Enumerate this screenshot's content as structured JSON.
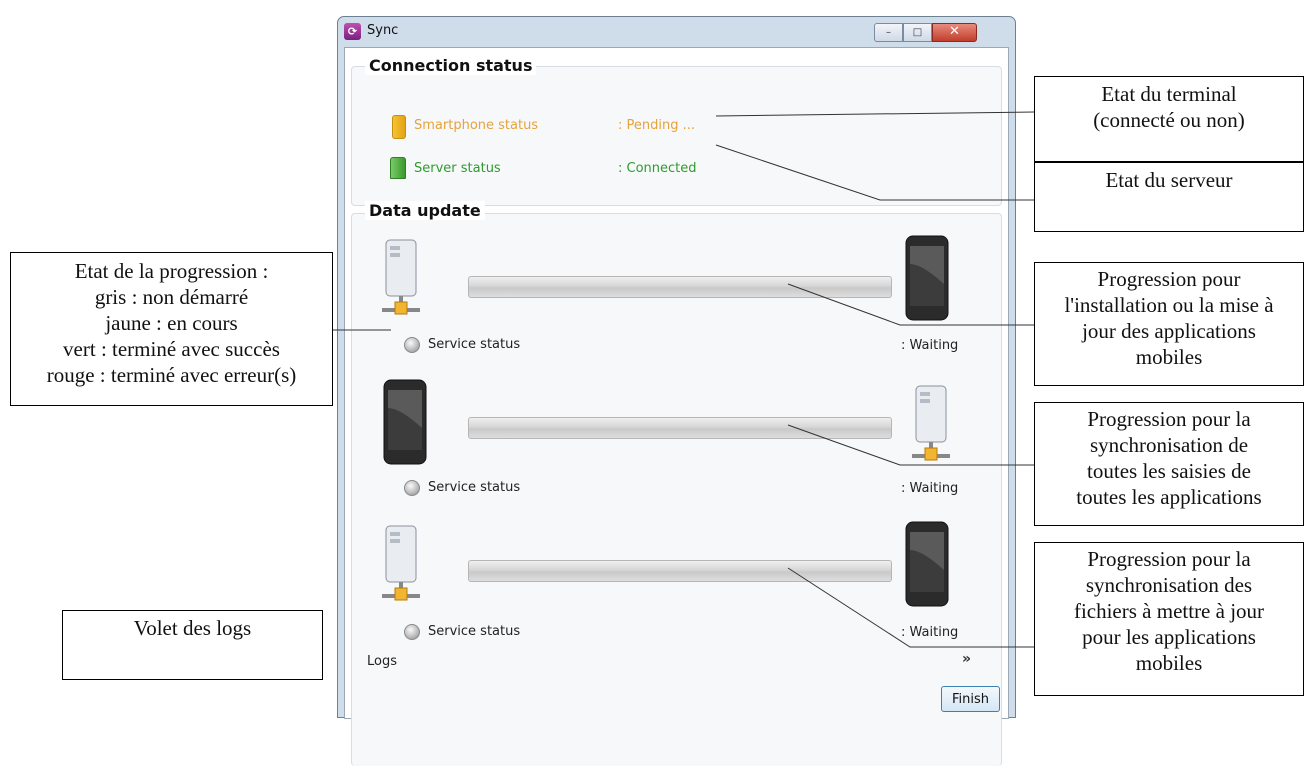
{
  "window": {
    "title": "Sync",
    "app_icon": "sync-app-icon",
    "controls": {
      "minimize": "–",
      "maximize": "□",
      "close": "✕"
    }
  },
  "connection_status": {
    "title": "Connection status",
    "smartphone": {
      "label": "Smartphone status",
      "value": ": Pending ...",
      "color": "#e6a23c",
      "icon": "smartphone-icon"
    },
    "server": {
      "label": "Server status",
      "value": ": Connected",
      "color": "#2f9a2f",
      "icon": "server-icon"
    }
  },
  "data_update": {
    "title": "Data update",
    "rows": [
      {
        "left_icon": "server-icon",
        "right_icon": "smartphone-icon",
        "service_label": "Service status",
        "status": ": Waiting",
        "progress": 0
      },
      {
        "left_icon": "smartphone-icon",
        "right_icon": "server-icon",
        "service_label": "Service status",
        "status": ": Waiting",
        "progress": 0
      },
      {
        "left_icon": "server-icon",
        "right_icon": "smartphone-icon",
        "service_label": "Service status",
        "status": ": Waiting",
        "progress": 0
      }
    ]
  },
  "logs": {
    "label": "Logs",
    "toggle_icon": "double-chevron-down-icon"
  },
  "finish_button": "Finish",
  "annotations": {
    "terminal": [
      "Etat du terminal",
      "(connecté ou non)"
    ],
    "server": [
      "Etat du serveur"
    ],
    "progress_legend": [
      "Etat de la progression :",
      "gris : non démarré",
      "jaune : en cours",
      "vert : terminé avec succès",
      "rouge : terminé avec erreur(s)"
    ],
    "install": [
      "Progression pour",
      "l'installation ou la mise à",
      "jour des applications",
      "mobiles"
    ],
    "sync_inputs": [
      "Progression pour la",
      "synchronisation de",
      "toutes les saisies de",
      "toutes les applications"
    ],
    "sync_files": [
      "Progression pour la",
      "synchronisation des",
      "fichiers à mettre à jour",
      "pour les applications",
      "mobiles"
    ],
    "logs_pane": [
      "Volet des logs"
    ]
  }
}
